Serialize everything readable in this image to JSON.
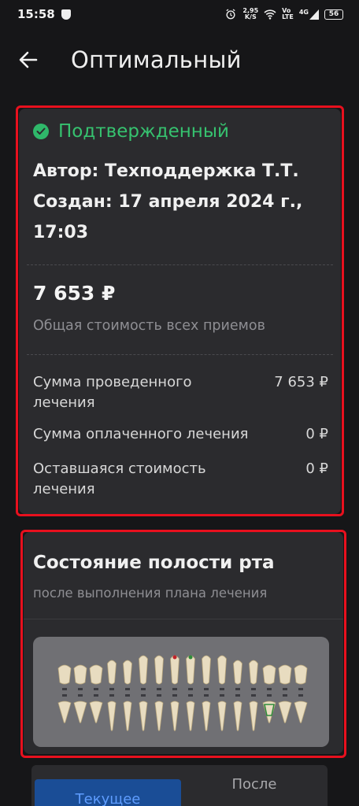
{
  "status_bar": {
    "time": "15:58",
    "net_speed_value": "2,95",
    "net_speed_unit": "K/S",
    "lte_top": "Vo",
    "lte_bottom": "LTE",
    "signal_label": "4G",
    "battery": "56"
  },
  "header": {
    "title": "Оптимальный"
  },
  "plan": {
    "status": "Подтвержденный",
    "author": "Автор: Техподдержка Т.Т.",
    "created": "Создан: 17 апреля 2024 г., 17:03",
    "total_amount": "7 653 ₽",
    "total_caption": "Общая стоимость всех приемов",
    "rows": [
      {
        "label": "Сумма проведенного лечения",
        "value": "7 653 ₽"
      },
      {
        "label": "Сумма оплаченного лечения",
        "value": "0 ₽"
      },
      {
        "label": "Оставшаяся стоимость лечения",
        "value": "0 ₽"
      }
    ]
  },
  "oral_state": {
    "title": "Состояние полости рта",
    "subtitle": "после выполнения плана лечения"
  },
  "toggle": {
    "current": "Текущее",
    "after": "После"
  },
  "colors": {
    "confirmed": "#36c26f",
    "highlight": "#e8101e",
    "active_tab": "#1a4d96"
  }
}
